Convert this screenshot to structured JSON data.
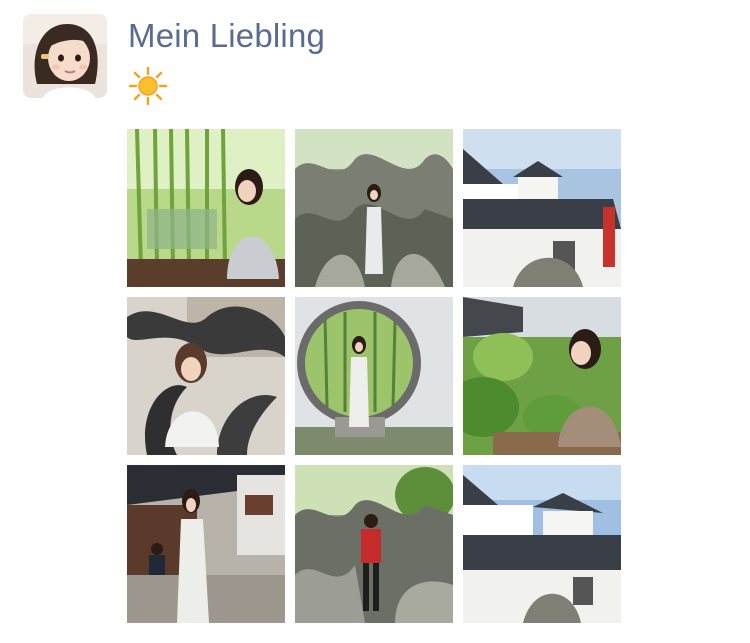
{
  "post": {
    "author": "Mein Liebling",
    "text_emoji": "☀️",
    "text_icon": "sun-icon"
  },
  "avatar": {
    "icon": "girl-portrait-avatar"
  },
  "photos": [
    {
      "icon": "photo-bamboo-forest"
    },
    {
      "icon": "photo-rockery-garden"
    },
    {
      "icon": "photo-white-wall-roof"
    },
    {
      "icon": "photo-dark-rock-sculpture"
    },
    {
      "icon": "photo-moon-gate"
    },
    {
      "icon": "photo-garden-greenery"
    },
    {
      "icon": "photo-pavilion-courtyard"
    },
    {
      "icon": "photo-rockery-red-shirt"
    },
    {
      "icon": "photo-white-wall-roof-2"
    }
  ]
}
